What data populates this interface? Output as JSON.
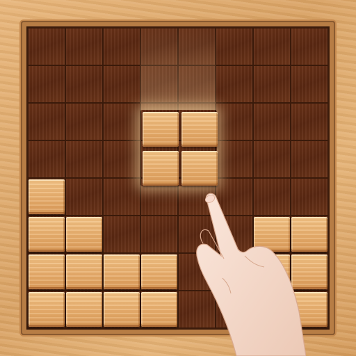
{
  "board": {
    "rows": 8,
    "cols": 8,
    "placed_blocks": [
      {
        "row": 4,
        "col": 0
      },
      {
        "row": 5,
        "col": 0
      },
      {
        "row": 5,
        "col": 1
      },
      {
        "row": 5,
        "col": 6
      },
      {
        "row": 5,
        "col": 7
      },
      {
        "row": 6,
        "col": 0
      },
      {
        "row": 6,
        "col": 1
      },
      {
        "row": 6,
        "col": 2
      },
      {
        "row": 6,
        "col": 3
      },
      {
        "row": 6,
        "col": 6
      },
      {
        "row": 6,
        "col": 7
      },
      {
        "row": 7,
        "col": 0
      },
      {
        "row": 7,
        "col": 1
      },
      {
        "row": 7,
        "col": 2
      },
      {
        "row": 7,
        "col": 3
      },
      {
        "row": 7,
        "col": 7
      }
    ]
  },
  "dragging_piece": {
    "shape": "2x2-square",
    "cells": [
      {
        "row": 2,
        "col": 3
      },
      {
        "row": 2,
        "col": 4
      },
      {
        "row": 3,
        "col": 3
      },
      {
        "row": 3,
        "col": 4
      }
    ],
    "highlight": "glow"
  },
  "icons": {
    "hand": "pointing-hand-icon"
  },
  "colors": {
    "frame_wood": "#dca367",
    "board_dark_wood": "#5a2812",
    "block_light_wood": "#e9b171",
    "glow": "#ffe1aa"
  }
}
